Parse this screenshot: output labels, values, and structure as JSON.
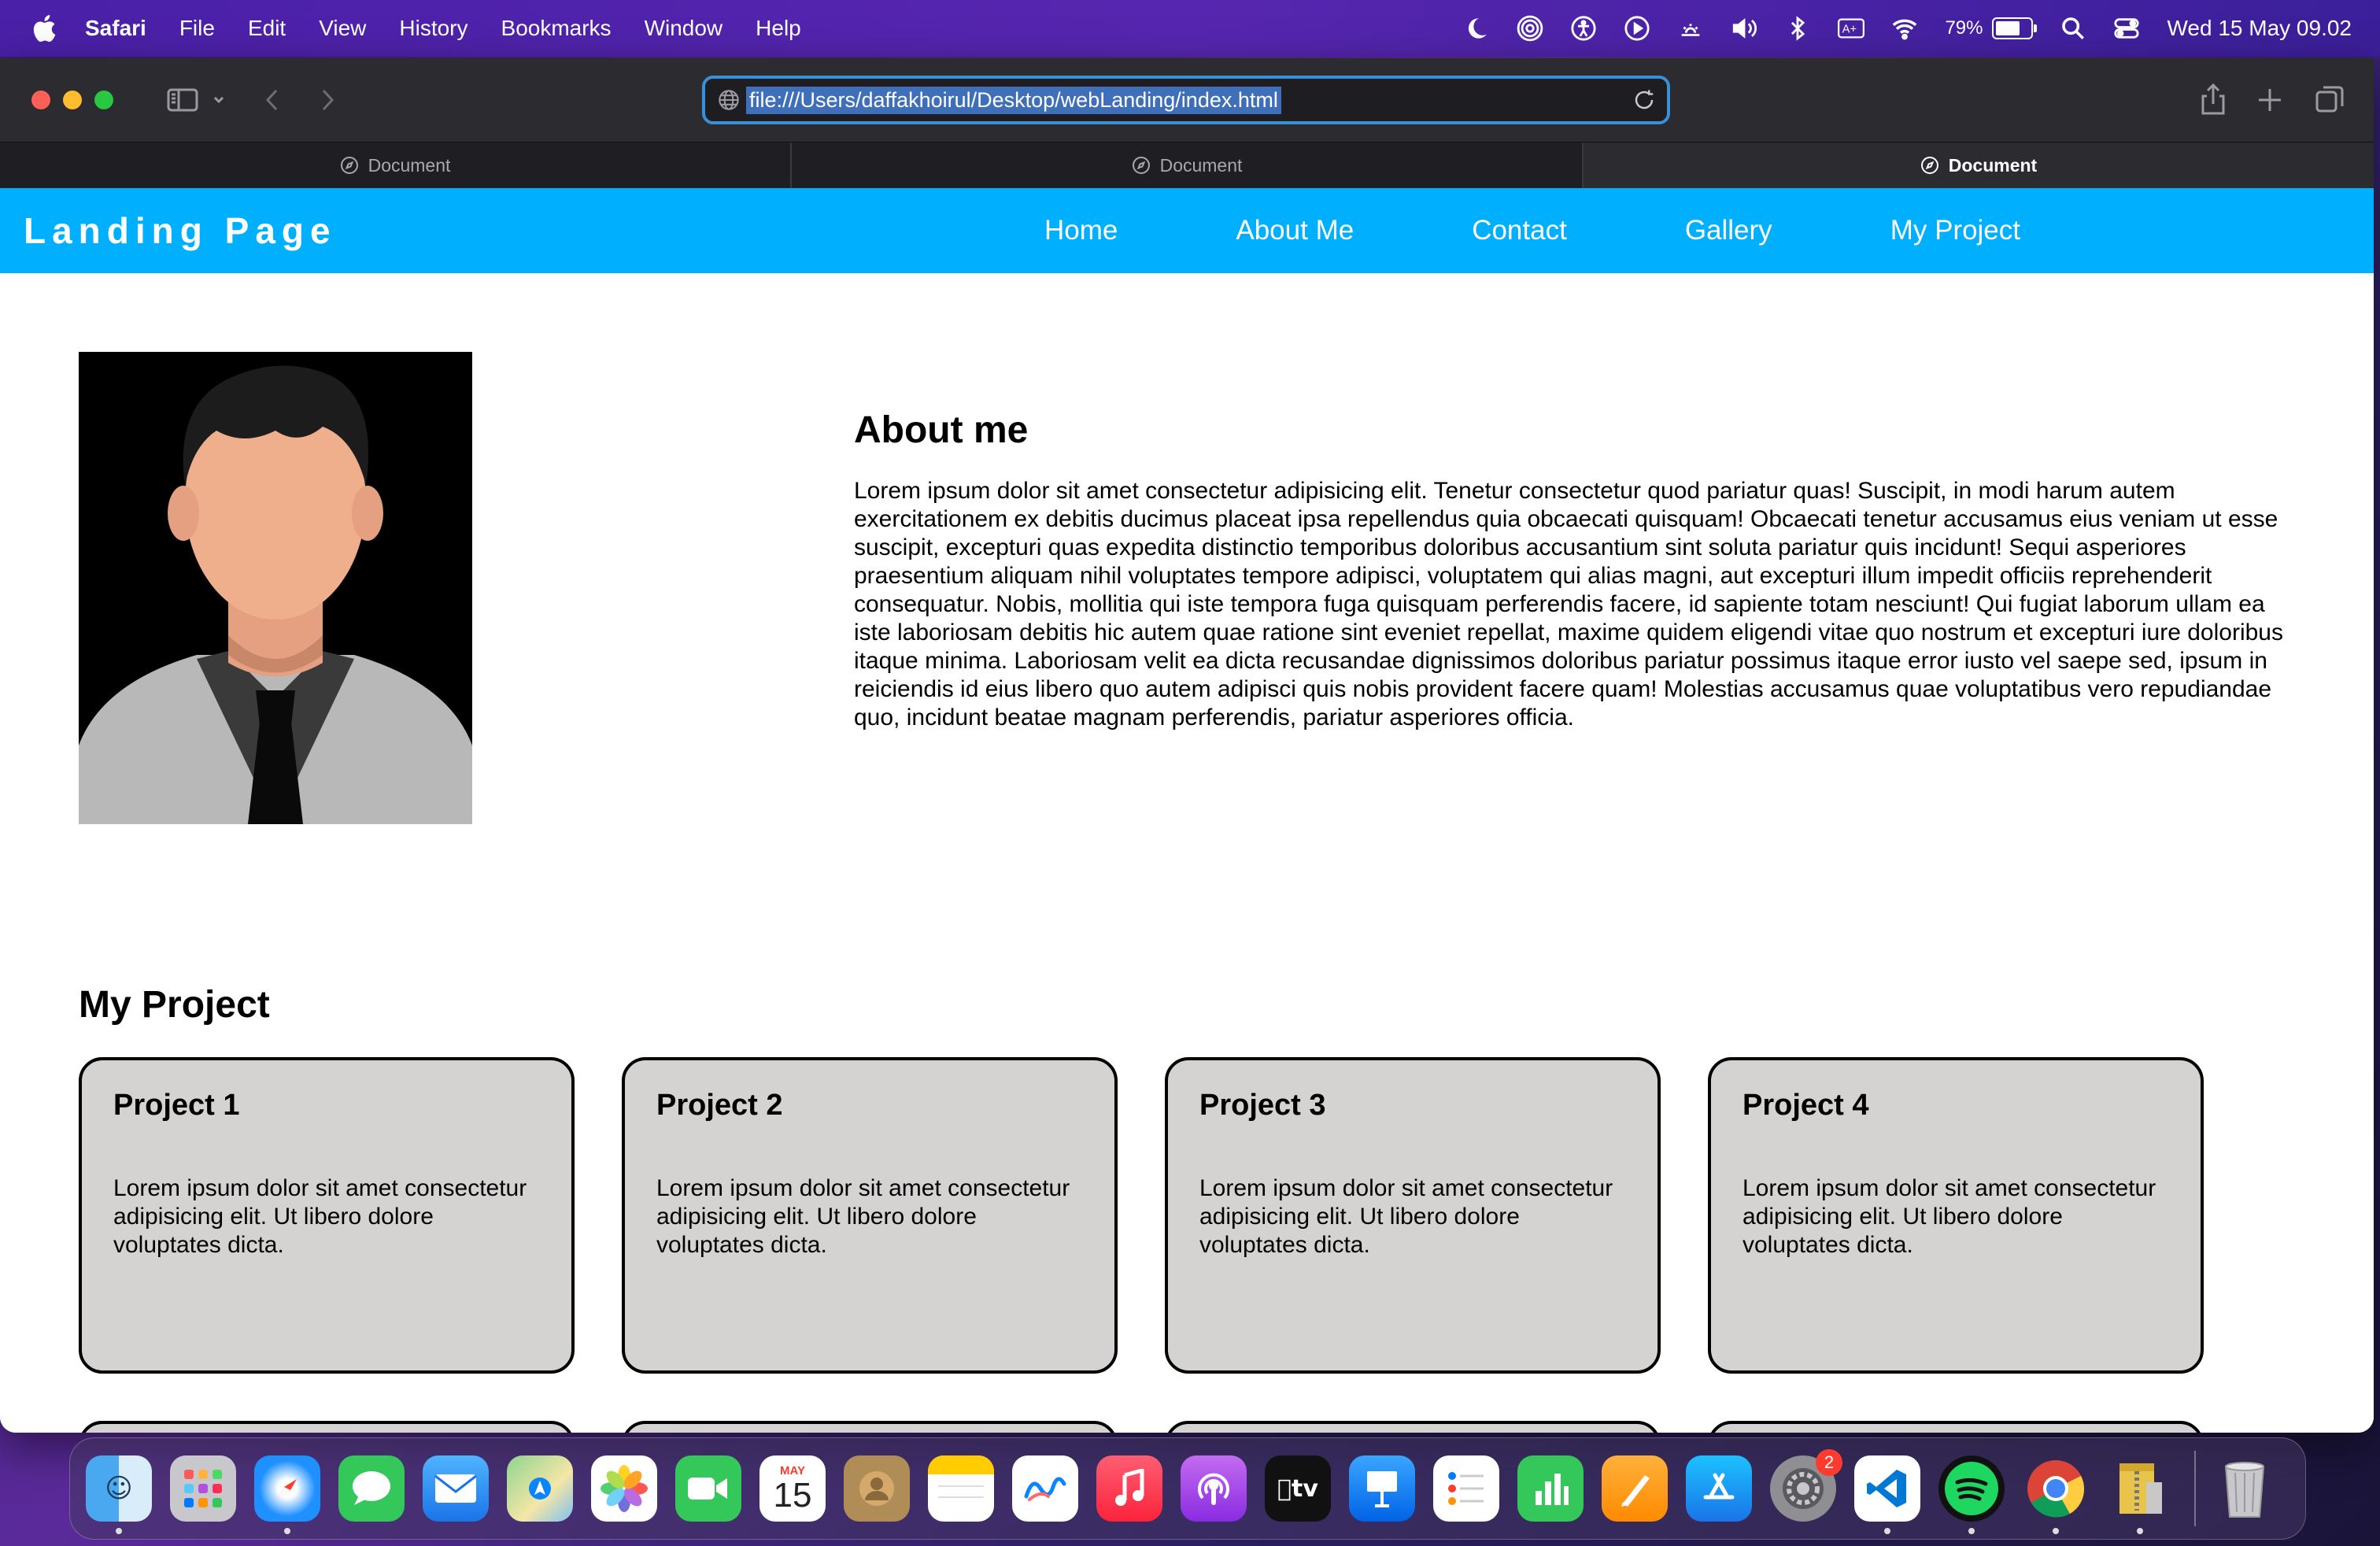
{
  "menubar": {
    "app_name": "Safari",
    "items": [
      "File",
      "Edit",
      "View",
      "History",
      "Bookmarks",
      "Window",
      "Help"
    ],
    "battery_percent": "79%",
    "battery_level": 0.79,
    "clock": "Wed 15 May  09.02"
  },
  "browser": {
    "url": "file:///Users/daffakhoirul/Desktop/webLanding/index.html",
    "tabs": [
      {
        "label": "Document",
        "active": false
      },
      {
        "label": "Document",
        "active": false
      },
      {
        "label": "Document",
        "active": true
      }
    ]
  },
  "page": {
    "brand": "Landing Page",
    "nav": [
      "Home",
      "About Me",
      "Contact",
      "Gallery",
      "My Project"
    ],
    "about": {
      "title": "About me",
      "body": "Lorem ipsum dolor sit amet consectetur adipisicing elit. Tenetur consectetur quod pariatur quas! Suscipit, in modi harum autem exercitationem ex debitis ducimus placeat ipsa repellendus quia obcaecati quisquam! Obcaecati tenetur accusamus eius veniam ut esse suscipit, excepturi quas expedita distinctio temporibus doloribus accusantium sint soluta pariatur quis incidunt! Sequi asperiores praesentium aliquam nihil voluptates tempore adipisci, voluptatem qui alias magni, aut excepturi illum impedit officiis reprehenderit consequatur. Nobis, mollitia qui iste tempora fuga quisquam perferendis facere, id sapiente totam nesciunt! Qui fugiat laborum ullam ea iste laboriosam debitis hic autem quae ratione sint eveniet repellat, maxime quidem eligendi vitae quo nostrum et excepturi iure doloribus itaque minima. Laboriosam velit ea dicta recusandae dignissimos doloribus pariatur possimus itaque error iusto vel saepe sed, ipsum in reiciendis id eius libero quo autem adipisci quis nobis provident facere quam! Molestias accusamus quae voluptatibus vero repudiandae quo, incidunt beatae magnam perferendis, pariatur asperiores officia."
    },
    "projects_title": "My Project",
    "projects": [
      {
        "title": "Project 1",
        "body": "Lorem ipsum dolor sit amet consectetur adipisicing elit. Ut libero dolore voluptates dicta."
      },
      {
        "title": "Project 2",
        "body": "Lorem ipsum dolor sit amet consectetur adipisicing elit. Ut libero dolore voluptates dicta."
      },
      {
        "title": "Project 3",
        "body": "Lorem ipsum dolor sit amet consectetur adipisicing elit. Ut libero dolore voluptates dicta."
      },
      {
        "title": "Project 4",
        "body": "Lorem ipsum dolor sit amet consectetur adipisicing elit. Ut libero dolore voluptates dicta."
      }
    ]
  },
  "dock": {
    "calendar_month": "MAY",
    "calendar_day": "15",
    "settings_badge": "2",
    "apps": [
      "finder",
      "launchpad",
      "safari",
      "messages",
      "mail",
      "maps",
      "photos",
      "facetime",
      "calendar",
      "contacts",
      "notes",
      "freeform",
      "music",
      "podcasts",
      "apple-tv",
      "keynote",
      "reminders",
      "numbers",
      "pages",
      "app-store",
      "system-settings",
      "vscode",
      "spotify",
      "chrome",
      "archive-utility",
      "trash"
    ]
  },
  "colors": {
    "navbar": "#00b0ff",
    "card_bg": "#d5d2d2",
    "url_focus": "#3a8fd9"
  }
}
